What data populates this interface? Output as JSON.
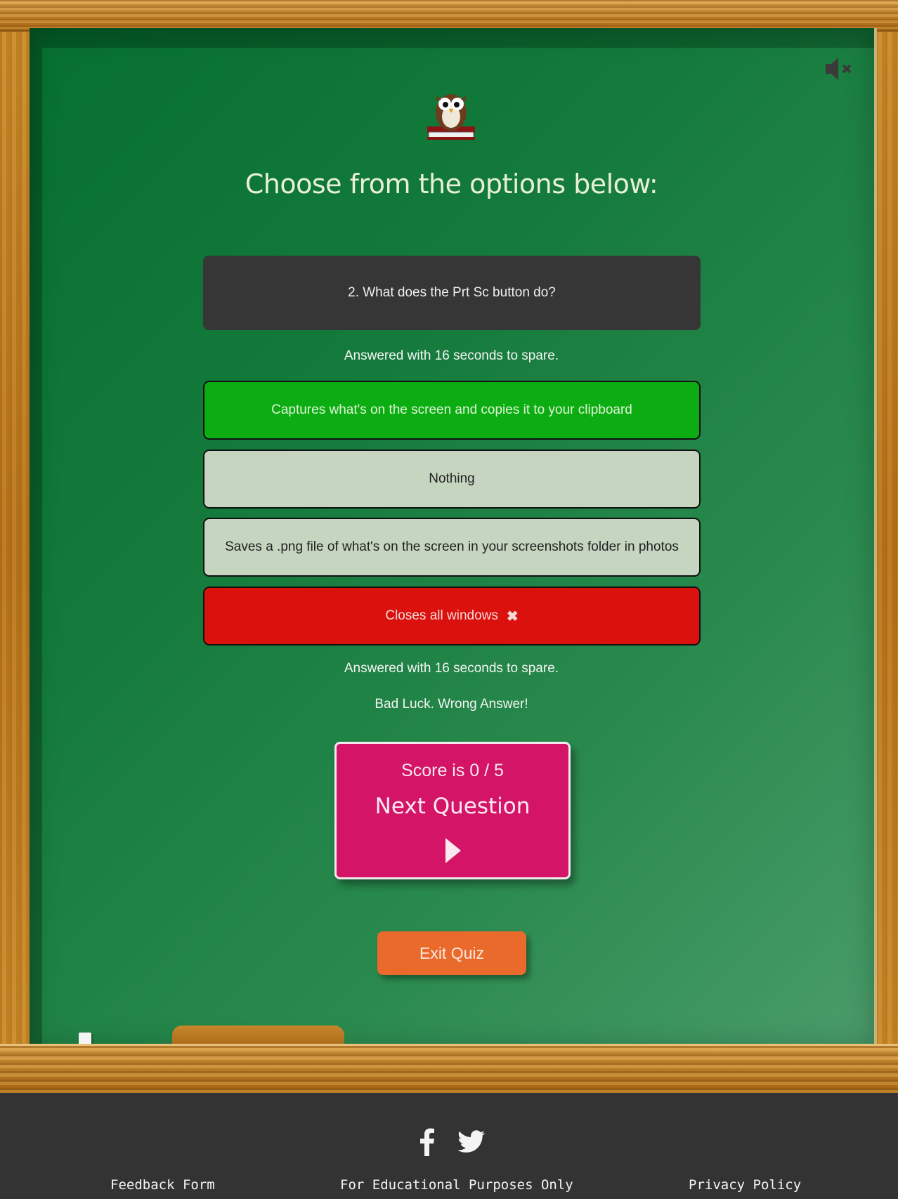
{
  "heading": "Choose from the options below:",
  "question": "2. What does the Prt Sc button do?",
  "time_status": "Answered with 16 seconds to spare.",
  "options": [
    {
      "label": "Captures what's on the screen and copies it to your clipboard",
      "state": "correct"
    },
    {
      "label": "Nothing",
      "state": "neutral"
    },
    {
      "label": "Saves a .png file of what's on the screen in your screenshots folder in photos",
      "state": "neutral"
    },
    {
      "label": "Closes all windows",
      "state": "wrong-selected"
    }
  ],
  "time_status_2": "Answered with 16 seconds to spare.",
  "result_message": "Bad Luck. Wrong Answer!",
  "score_card": {
    "score": "Score is 0 / 5",
    "next_label": "Next Question"
  },
  "exit_label": "Exit Quiz",
  "footer": {
    "feedback": "Feedback Form",
    "notice": "For Educational Purposes Only",
    "privacy": "Privacy Policy"
  },
  "icons": {
    "mute": "speaker-muted-icon",
    "mascot": "owl-icon",
    "wrong": "x-mark-icon",
    "next": "play-triangle-icon",
    "social": [
      "facebook-icon",
      "twitter-icon"
    ]
  },
  "colors": {
    "board": "#137a3b",
    "correct": "#0cad12",
    "neutral": "#c5d5c0",
    "wrong": "#db110d",
    "score_card": "#d41466",
    "exit": "#ea6a2c",
    "footer": "#333333"
  }
}
